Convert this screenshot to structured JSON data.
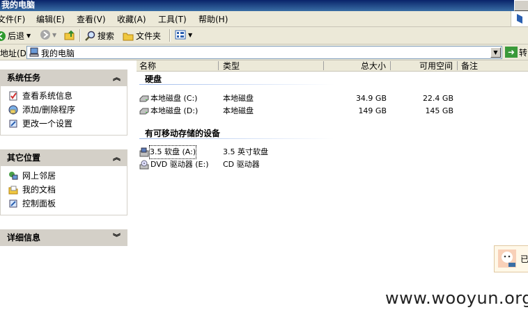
{
  "window": {
    "title": "我的电脑"
  },
  "menu": [
    "文件(F)",
    "编辑(E)",
    "查看(V)",
    "收藏(A)",
    "工具(T)",
    "帮助(H)"
  ],
  "toolbar": {
    "back": "后退",
    "search": "搜索",
    "folders": "文件夹"
  },
  "address": {
    "label": "地址(D)",
    "value": "我的电脑",
    "go": "转"
  },
  "tasks": {
    "system": {
      "title": "系统任务",
      "items": [
        "查看系统信息",
        "添加/删除程序",
        "更改一个设置"
      ]
    },
    "other": {
      "title": "其它位置",
      "items": [
        "网上邻居",
        "我的文档",
        "控制面板"
      ]
    },
    "details": {
      "title": "详细信息"
    }
  },
  "columns": [
    "名称",
    "类型",
    "总大小",
    "可用空间",
    "备注"
  ],
  "groups": {
    "hard_disks": "硬盘",
    "removable": "有可移动存储的设备"
  },
  "drives": [
    {
      "name": "本地磁盘 (C:)",
      "type": "本地磁盘",
      "total": "34.9 GB",
      "free": "22.4 GB"
    },
    {
      "name": "本地磁盘 (D:)",
      "type": "本地磁盘",
      "total": "149 GB",
      "free": "145 GB"
    }
  ],
  "removable": [
    {
      "name": "3.5 软盘 (A:)",
      "type": "3.5 英寸软盘"
    },
    {
      "name": "DVD 驱动器 (E:)",
      "type": "CD 驱动器"
    }
  ],
  "balloon": {
    "text": "已"
  },
  "watermark": "www.wooyun.org"
}
